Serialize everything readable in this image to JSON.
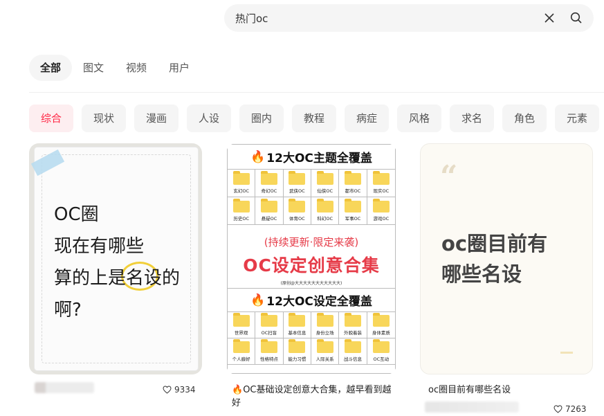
{
  "search": {
    "value": "热门oc",
    "clear_icon": "close-icon",
    "search_icon": "search-icon"
  },
  "tabs": [
    "全部",
    "图文",
    "视频",
    "用户"
  ],
  "active_tab": 0,
  "filters": [
    "综合",
    "现状",
    "漫画",
    "人设",
    "圈内",
    "教程",
    "病症",
    "风格",
    "求名",
    "角色",
    "元素"
  ],
  "active_filter": 0,
  "accent_color": "#ff2442",
  "cards": [
    {
      "image_text": "OC圈\n现在有哪些\n算的上是名设的\n啊?",
      "likes": "9334"
    },
    {
      "header1": "12大OC主题全覆盖",
      "grid1": [
        "玄幻OC",
        "奇幻OC",
        "武侠OC",
        "仙侠OC",
        "都市OC",
        "现实OC",
        "历史OC",
        "悬疑OC",
        "体育OC",
        "科幻OC",
        "军事OC",
        "游戏OC"
      ],
      "sub": "(持续更新·限定来袭)",
      "big": "OC设定创意合集",
      "tiny": "(原创@大大大大大大大大大大大)",
      "header2": "12大OC设定全覆盖",
      "grid2": [
        "世界观",
        "OC扫盲",
        "基本信息",
        "身份立场",
        "外貌着装",
        "身体素质",
        "个人癖好",
        "性格特点",
        "能力习惯",
        "人际关系",
        "战斗信息",
        "OC互动"
      ],
      "caption": "OC基础设定创意大合集，越早看到越好"
    },
    {
      "quote": "“",
      "image_text": "oc圈目前有\n哪些名设",
      "caption": "oc圈目前有哪些名设",
      "likes": "7263"
    }
  ]
}
